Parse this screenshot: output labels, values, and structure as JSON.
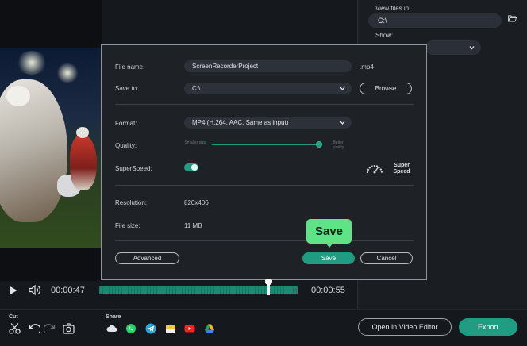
{
  "dialog": {
    "file_name_label": "File name:",
    "file_name_value": "ScreenRecorderProject",
    "extension": ".mp4",
    "save_to_label": "Save to:",
    "save_to_value": "C:\\",
    "browse_label": "Browse",
    "format_label": "Format:",
    "format_value": "MP4 (H.264, AAC, Same as input)",
    "quality_label": "Quality:",
    "quality_smaller": "Smaller size",
    "quality_better": "Better quality",
    "quality_level": 1.0,
    "superspeed_label": "SuperSpeed:",
    "superspeed_on": true,
    "super_speed_text": "Super Speed",
    "resolution_label": "Resolution:",
    "resolution_value": "820x406",
    "file_size_label": "File size:",
    "file_size_value": "11 MB",
    "advanced_label": "Advanced",
    "save_label": "Save",
    "cancel_label": "Cancel"
  },
  "tooltip": {
    "text": "Save",
    "color": "#5ee387"
  },
  "right_panel": {
    "view_files_label": "View files in:",
    "view_files_value": "C:\\",
    "show_label": "Show:"
  },
  "playback": {
    "current_time": "00:00:47",
    "end_time": "00:00:55",
    "progress": 0.85
  },
  "toolbar": {
    "cut_label": "Cut",
    "share_label": "Share",
    "open_editor_label": "Open in Video Editor",
    "export_label": "Export",
    "share_icons": [
      "cloud-icon",
      "whatsapp-icon",
      "telegram-icon",
      "folder-share-icon",
      "youtube-icon",
      "google-drive-icon"
    ]
  },
  "colors": {
    "accent": "#1f9c81",
    "background": "#15181c",
    "dialog_bg": "#1e2126"
  }
}
